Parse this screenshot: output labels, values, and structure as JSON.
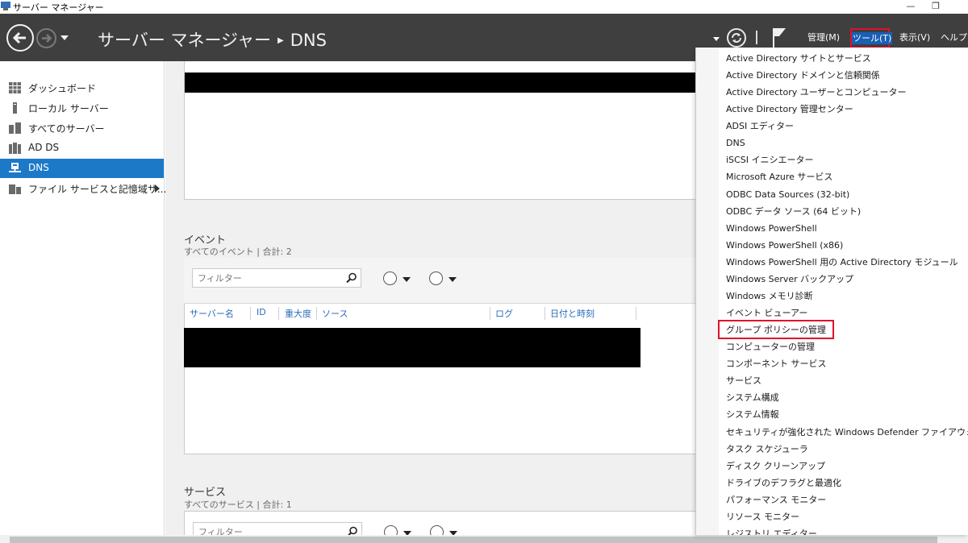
{
  "window": {
    "title": "サーバー マネージャー",
    "minimize": "—",
    "restore": "❐"
  },
  "header": {
    "breadcrumb_app": "サーバー マネージャー",
    "breadcrumb_sep": "▶",
    "breadcrumb_page": "DNS",
    "menus": {
      "manage": "管理(M)",
      "tools": "ツール(T)",
      "view": "表示(V)",
      "help": "ヘルプ(H)"
    }
  },
  "sidebar": {
    "items": [
      {
        "label": "ダッシュボード",
        "icon": "dashboard-icon"
      },
      {
        "label": "ローカル サーバー",
        "icon": "local-server-icon"
      },
      {
        "label": "すべてのサーバー",
        "icon": "all-servers-icon"
      },
      {
        "label": "AD DS",
        "icon": "ad-ds-icon"
      },
      {
        "label": "DNS",
        "icon": "dns-icon",
        "active": true
      },
      {
        "label": "ファイル サービスと記憶域サ...",
        "icon": "file-services-icon"
      }
    ]
  },
  "events": {
    "title": "イベント",
    "subtitle": "すべてのイベント | 合計: 2",
    "filter_placeholder": "フィルター",
    "columns": [
      "サーバー名",
      "ID",
      "重大度",
      "ソース",
      "ログ",
      "日付と時刻"
    ]
  },
  "services": {
    "title": "サービス",
    "subtitle": "すべてのサービス | 合計: 1",
    "filter_placeholder": "フィルター"
  },
  "tools_menu": {
    "items": [
      "Active Directory サイトとサービス",
      "Active Directory ドメインと信頼関係",
      "Active Directory ユーザーとコンピューター",
      "Active Directory 管理センター",
      "ADSI エディター",
      "DNS",
      "iSCSI イニシエーター",
      "Microsoft Azure サービス",
      "ODBC Data Sources (32-bit)",
      "ODBC データ ソース (64 ビット)",
      "Windows PowerShell",
      "Windows PowerShell (x86)",
      "Windows PowerShell 用の Active Directory モジュール",
      "Windows Server バックアップ",
      "Windows メモリ診断",
      "イベント ビューアー",
      "グループ ポリシーの管理",
      "コンピューターの管理",
      "コンポーネント サービス",
      "サービス",
      "システム構成",
      "システム情報",
      "セキュリティが強化された Windows Defender ファイアウォール",
      "タスク スケジューラ",
      "ディスク クリーンアップ",
      "ドライブのデフラグと最適化",
      "パフォーマンス モニター",
      "リソース モニター",
      "レジストリ エディター"
    ],
    "highlighted": "グループ ポリシーの管理"
  },
  "colors": {
    "header_bg": "#3f3f3f",
    "active_nav": "#1c79c8",
    "highlight_box": "#e0102c",
    "column_header": "#2a6ebb"
  }
}
